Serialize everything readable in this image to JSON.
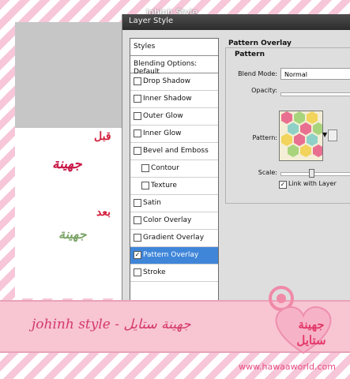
{
  "header": {
    "title": "Johinh Style"
  },
  "preview": {
    "before_label": "قبل",
    "sample_before": "جهينة",
    "after_label": "بعد",
    "sample_after": "جهينة"
  },
  "dialog": {
    "title": "Layer Style",
    "sidebar": [
      {
        "label": "Styles",
        "type": "header"
      },
      {
        "label": "Blending Options: Default",
        "type": "header"
      },
      {
        "label": "Drop Shadow",
        "checked": false
      },
      {
        "label": "Inner Shadow",
        "checked": false
      },
      {
        "label": "Outer Glow",
        "checked": false
      },
      {
        "label": "Inner Glow",
        "checked": false
      },
      {
        "label": "Bevel and Emboss",
        "checked": false
      },
      {
        "label": "Contour",
        "checked": false,
        "indent": true
      },
      {
        "label": "Texture",
        "checked": false,
        "indent": true
      },
      {
        "label": "Satin",
        "checked": false
      },
      {
        "label": "Color Overlay",
        "checked": false
      },
      {
        "label": "Gradient Overlay",
        "checked": false
      },
      {
        "label": "Pattern Overlay",
        "checked": true,
        "selected": true
      },
      {
        "label": "Stroke",
        "checked": false
      }
    ],
    "panel": {
      "group_title": "Pattern Overlay",
      "section_title": "Pattern",
      "blend_mode_label": "Blend Mode:",
      "blend_mode_value": "Normal",
      "opacity_label": "Opacity:",
      "pattern_label": "Pattern:",
      "scale_label": "Scale:",
      "link_label": "Link with Layer",
      "link_checked": true
    }
  },
  "banner": {
    "text": "johinh style - جهينة ستايل",
    "badge_line1": "جهينة",
    "badge_line2": "ستايل",
    "site": "www.hawaaworld.com"
  },
  "colors": {
    "accent": "#d4396b",
    "selected_row": "#3f86d9",
    "stripe_pink": "#f7c6d8"
  }
}
